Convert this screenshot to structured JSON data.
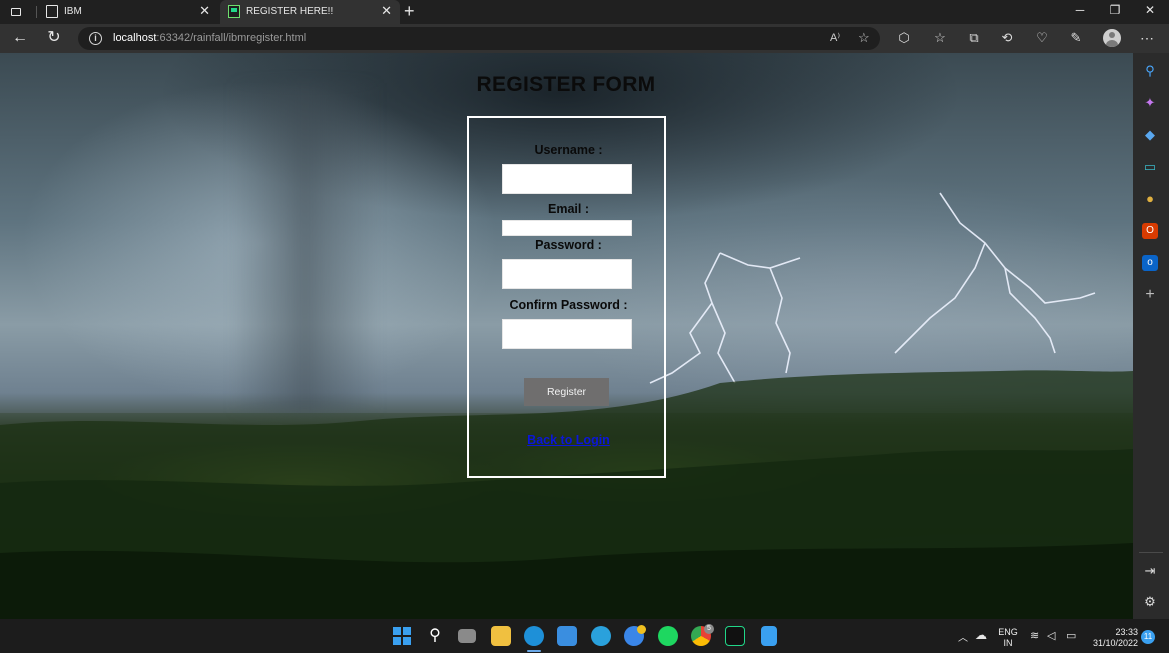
{
  "browser": {
    "tabs": [
      {
        "title": "IBM",
        "active": false,
        "icon": "document-icon"
      },
      {
        "title": "REGISTER HERE!!",
        "active": true,
        "icon": "pycharm-icon"
      }
    ],
    "url_host": "localhost",
    "url_rest": ":63342/rainfall/ibmregister.html",
    "read_aloud_label": "A⁾"
  },
  "page": {
    "title": "REGISTER FORM",
    "form": {
      "username_label": "Username :",
      "email_label": "Email :",
      "password_label": "Password :",
      "confirm_password_label": "Confirm Password :",
      "username_value": "",
      "email_value": "",
      "password_value": "",
      "confirm_password_value": "",
      "register_button": "Register",
      "back_link": "Back to Login"
    }
  },
  "taskbar": {
    "language_line1": "ENG",
    "language_line2": "IN",
    "time": "23:33",
    "date": "31/10/2022",
    "notification_count": "11",
    "chrome_badge": "5"
  },
  "colors": {
    "accent": "#3aa0f0",
    "form_border": "#ffffff",
    "link": "#0b16d9",
    "button": "#6f6e6e"
  }
}
